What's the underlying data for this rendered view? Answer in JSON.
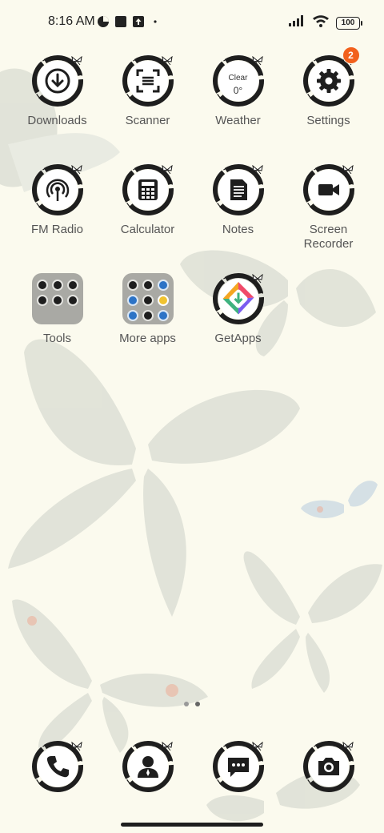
{
  "status_bar": {
    "time": "8:16 AM",
    "battery": "100",
    "icons": [
      "data-saver-icon",
      "square-notification-icon",
      "upload-icon",
      "dot-icon",
      "signal-icon",
      "wifi-icon",
      "battery-icon"
    ]
  },
  "apps": [
    {
      "label": "Downloads",
      "icon": "download-icon"
    },
    {
      "label": "Scanner",
      "icon": "scanner-icon"
    },
    {
      "label": "Weather",
      "icon": "weather-icon",
      "condition": "Clear",
      "temp": "0°"
    },
    {
      "label": "Settings",
      "icon": "gear-icon",
      "badge": "2"
    },
    {
      "label": "FM Radio",
      "icon": "radio-icon"
    },
    {
      "label": "Calculator",
      "icon": "calculator-icon"
    },
    {
      "label": "Notes",
      "icon": "notes-icon"
    },
    {
      "label": "Screen Recorder",
      "icon": "video-camera-icon"
    },
    {
      "label": "Tools",
      "icon": "folder-icon"
    },
    {
      "label": "More apps",
      "icon": "folder-icon"
    },
    {
      "label": "GetApps",
      "icon": "getapps-icon"
    }
  ],
  "dock": [
    {
      "name": "phone",
      "icon": "phone-icon"
    },
    {
      "name": "contacts",
      "icon": "contact-icon"
    },
    {
      "name": "messages",
      "icon": "message-icon"
    },
    {
      "name": "camera",
      "icon": "camera-icon"
    }
  ],
  "page_indicator": {
    "pages": 2,
    "current": 2
  },
  "colors": {
    "background": "#fbfaee",
    "ink": "#1e1e1e",
    "badge": "#f2601c",
    "label": "#555555"
  }
}
